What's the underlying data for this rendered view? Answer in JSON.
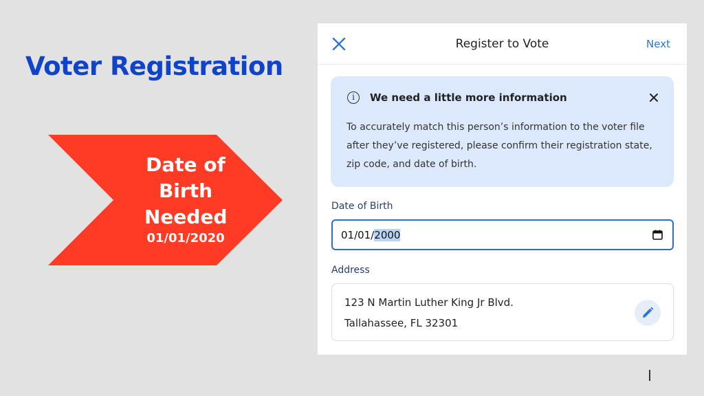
{
  "slide": {
    "title": "Voter Registration",
    "callout": {
      "lines": [
        "Date of",
        "Birth",
        "Needed"
      ],
      "date": "01/01/2020",
      "color": "#ff3b25"
    }
  },
  "dialog": {
    "title": "Register to Vote",
    "next_label": "Next",
    "close_icon": "close-icon",
    "info": {
      "heading": "We need a little more information",
      "body": "To accurately match this person’s information to the voter file after they’ve registered, please confirm their registration state, zip code, and date of birth.",
      "icon": "info-icon",
      "background": "#dce8fb"
    },
    "date_of_birth": {
      "label": "Date of Birth",
      "value_prefix": "01/01/",
      "value_selected": "2000",
      "icon": "calendar-icon"
    },
    "address": {
      "label": "Address",
      "line1": "123 N Martin Luther King Jr Blvd.",
      "line2": "Tallahassee, FL 32301",
      "edit_icon": "pencil-icon"
    },
    "accent_color": "#2f74d6"
  }
}
